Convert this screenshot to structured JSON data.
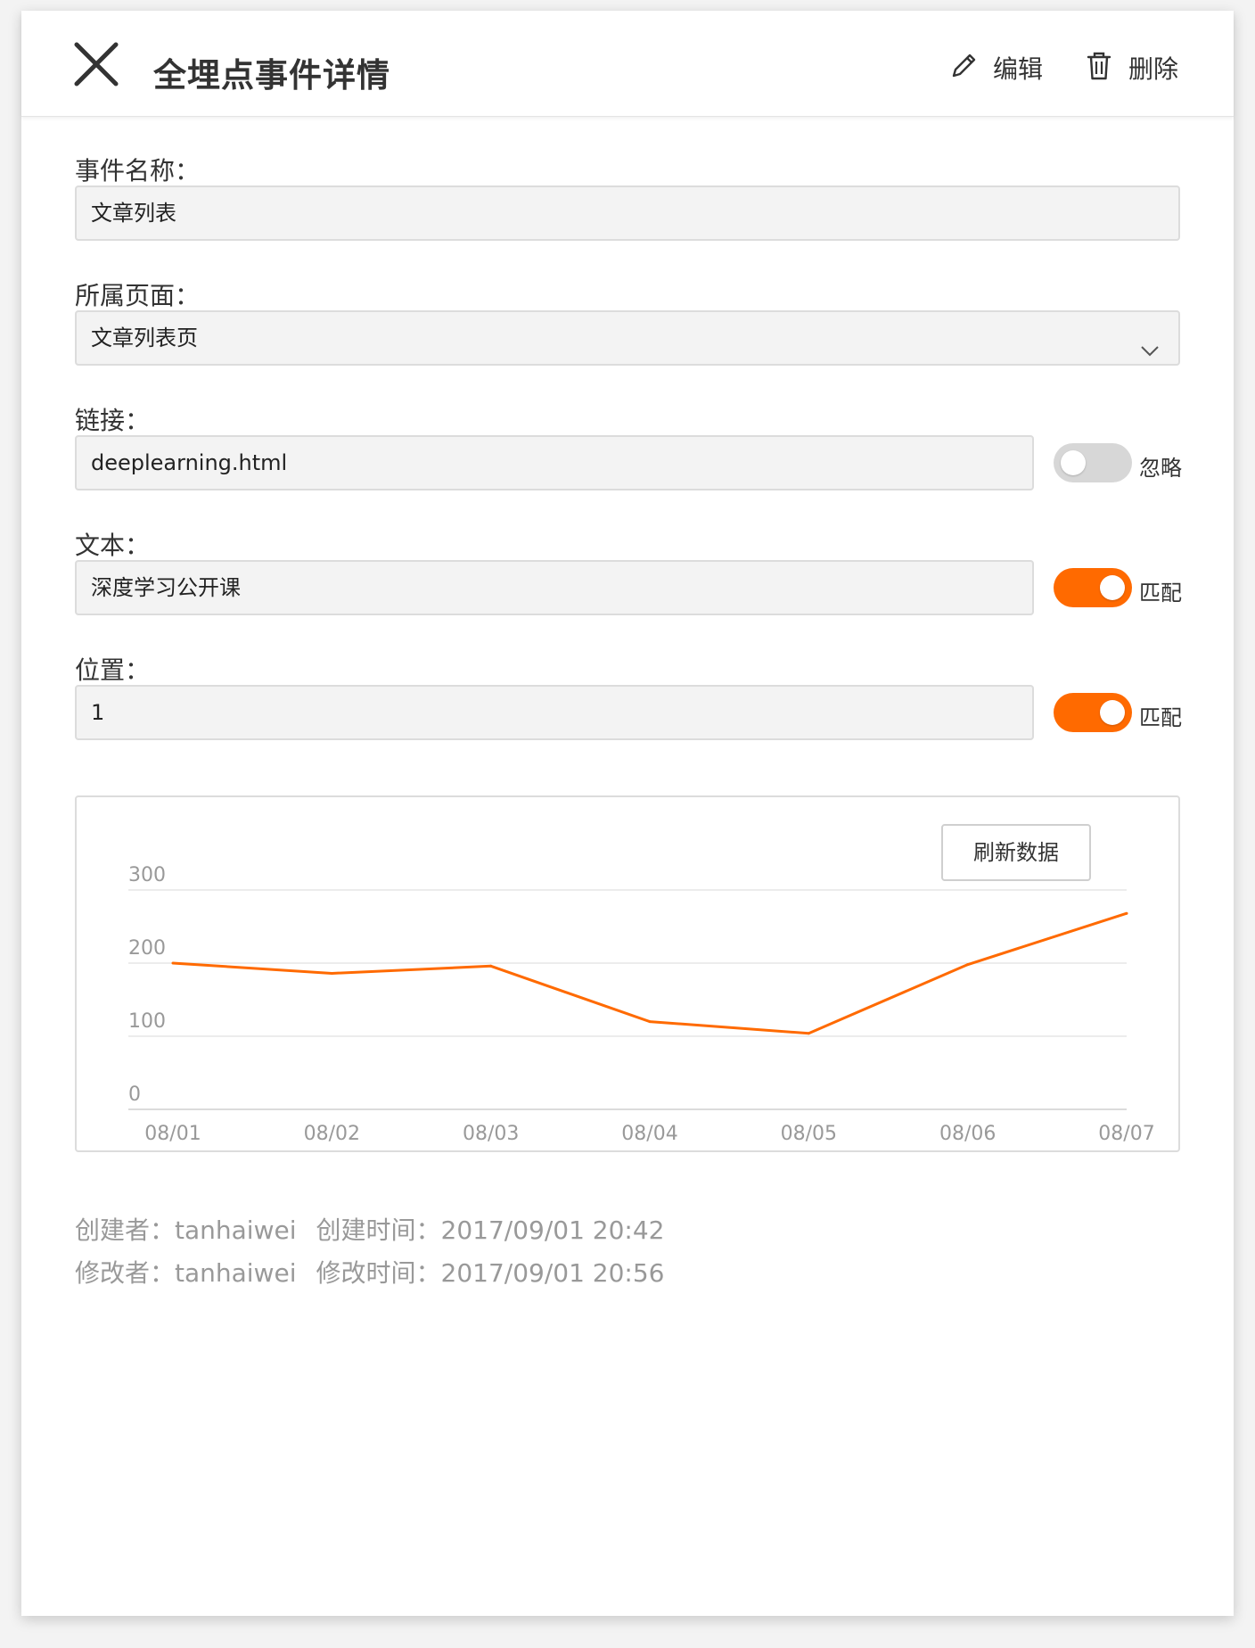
{
  "header": {
    "title": "全埋点事件详情",
    "edit_label": "编辑",
    "delete_label": "删除"
  },
  "form": {
    "event_name": {
      "label": "事件名称：",
      "value": "文章列表"
    },
    "page": {
      "label": "所属页面：",
      "value": "文章列表页"
    },
    "link": {
      "label": "链接：",
      "value": "deeplearning.html",
      "toggle": "off",
      "toggle_label": "忽略"
    },
    "text": {
      "label": "文本：",
      "value": "深度学习公开课",
      "toggle": "on",
      "toggle_label": "匹配"
    },
    "position": {
      "label": "位置：",
      "value": "1",
      "toggle": "on",
      "toggle_label": "匹配"
    }
  },
  "chart": {
    "refresh_label": "刷新数据"
  },
  "chart_data": {
    "type": "line",
    "categories": [
      "08/01",
      "08/02",
      "08/03",
      "08/04",
      "08/05",
      "08/06",
      "08/07"
    ],
    "series": [
      {
        "values": [
          200,
          186,
          196,
          120,
          104,
          198,
          268
        ]
      }
    ],
    "ylim": [
      0,
      300
    ],
    "yticks": [
      0,
      100,
      200,
      300
    ],
    "grid": true,
    "color": "#ff6a00",
    "title": "",
    "xlabel": "",
    "ylabel": ""
  },
  "meta": {
    "creator_label": "创建者：",
    "creator": "tanhaiwei",
    "created_time_label": "创建时间：",
    "created_time": "2017/09/01 20:42",
    "modifier_label": "修改者：",
    "modifier": "tanhaiwei",
    "modified_time_label": "修改时间：",
    "modified_time": "2017/09/01 20:56"
  },
  "colors": {
    "accent": "#ff6a00",
    "toggle_off": "#d7d7d7",
    "field_bg": "#f3f3f3"
  }
}
